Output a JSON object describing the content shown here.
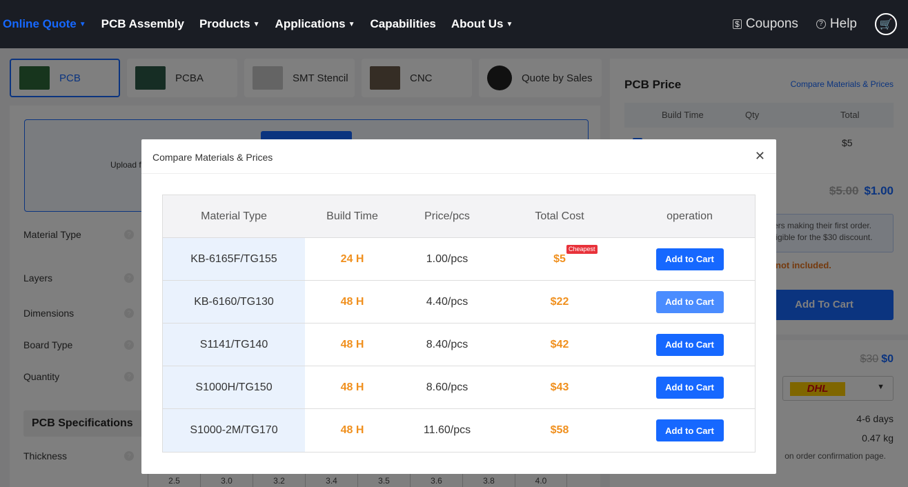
{
  "nav": {
    "items": [
      {
        "label": "Online Quote",
        "chevron": true,
        "active": true
      },
      {
        "label": "PCB Assembly",
        "chevron": false
      },
      {
        "label": "Products",
        "chevron": true
      },
      {
        "label": "Applications",
        "chevron": true
      },
      {
        "label": "Capabilities",
        "chevron": false
      },
      {
        "label": "About Us",
        "chevron": true
      }
    ],
    "coupons": "Coupons",
    "help": "Help"
  },
  "product_tabs": [
    {
      "label": "PCB",
      "icon": "pcb-thumb"
    },
    {
      "label": "PCBA",
      "icon": "pcba-thumb"
    },
    {
      "label": "SMT Stencil",
      "icon": "stencil-thumb"
    },
    {
      "label": "CNC",
      "icon": "cnc-thumb"
    },
    {
      "label": "Quote by Sales",
      "icon": "headset-icon"
    }
  ],
  "form": {
    "upload_text": "Upload f",
    "labels": [
      "Material Type",
      "Layers",
      "Dimensions",
      "Board Type",
      "Quantity"
    ],
    "spec_header": "PCB Specifications",
    "thickness_label": "Thickness",
    "thickness_options": [
      "2.5",
      "3.0",
      "3.2",
      "3.4",
      "3.5",
      "3.6",
      "3.8",
      "4.0"
    ]
  },
  "price_panel": {
    "title": "PCB Price",
    "compare_link": "Compare Materials & Prices",
    "columns": [
      "Build Time",
      "Qty",
      "Total"
    ],
    "row_total": "$5",
    "old_price": "$5.00",
    "new_price": "$1.00",
    "notice_line1": "sers making their first order.",
    "notice_line2": "eligible for the $30 discount.",
    "warning": "not included.",
    "add_to_cart": "Add To Cart"
  },
  "shipping": {
    "old_price": "$30",
    "new_price": "$0",
    "carrier": "DHL",
    "days": "4-6 days",
    "weight": "0.47 kg",
    "note": "on order confirmation page."
  },
  "modal": {
    "title": "Compare Materials & Prices",
    "columns": [
      "Material Type",
      "Build Time",
      "Price/pcs",
      "Total Cost",
      "operation"
    ],
    "cheapest_badge": "Cheapest",
    "rows": [
      {
        "material": "KB-6165F/TG155",
        "build_time": "24 H",
        "price": "1.00/pcs",
        "total": "$5",
        "button": "Add to Cart"
      },
      {
        "material": "KB-6160/TG130",
        "build_time": "48 H",
        "price": "4.40/pcs",
        "total": "$22",
        "button": "Add to Cart"
      },
      {
        "material": "S1141/TG140",
        "build_time": "48 H",
        "price": "8.40/pcs",
        "total": "$42",
        "button": "Add to Cart"
      },
      {
        "material": "S1000H/TG150",
        "build_time": "48 H",
        "price": "8.60/pcs",
        "total": "$43",
        "button": "Add to Cart"
      },
      {
        "material": "S1000-2M/TG170",
        "build_time": "48 H",
        "price": "11.60/pcs",
        "total": "$58",
        "button": "Add to Cart"
      }
    ]
  },
  "colors": {
    "accent": "#1668ff",
    "price_orange": "#f0901e",
    "badge_red": "#e8323a",
    "nav_bg": "#1a1d24"
  }
}
